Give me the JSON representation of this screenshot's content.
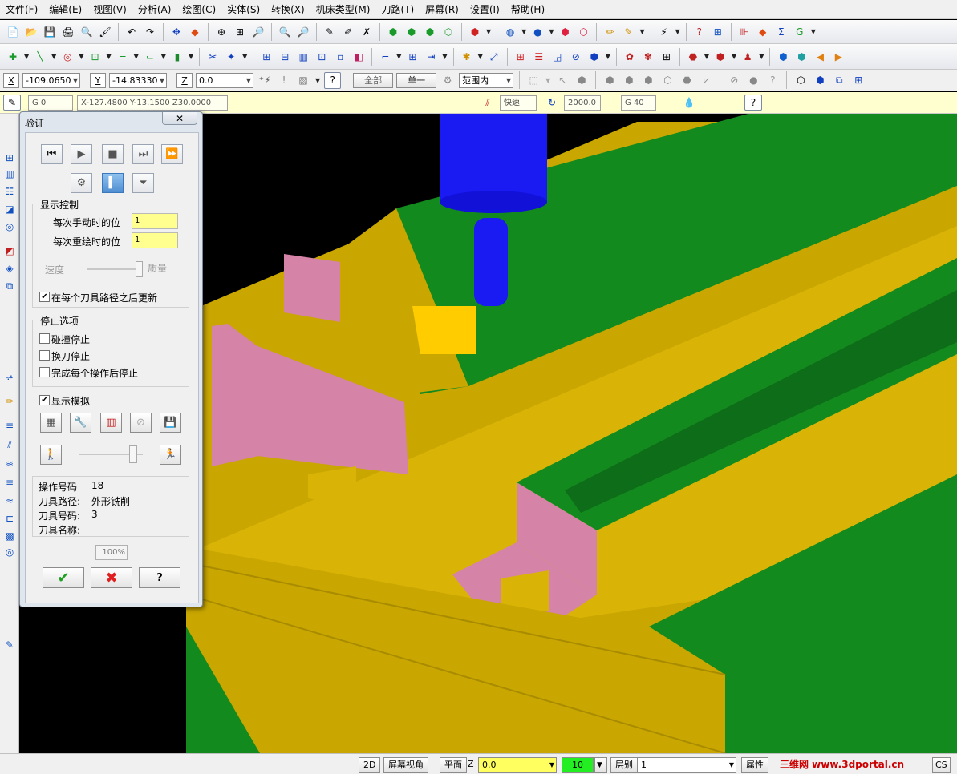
{
  "menu": [
    "文件(F)",
    "编辑(E)",
    "视图(V)",
    "分析(A)",
    "绘图(C)",
    "实体(S)",
    "转换(X)",
    "机床类型(M)",
    "刀路(T)",
    "屏幕(R)",
    "设置(I)",
    "帮助(H)"
  ],
  "coords": {
    "x_label": "X",
    "x_value": "-109.0650",
    "y_label": "Y",
    "y_value": "-14.83330",
    "z_label": "Z",
    "z_value": "0.0"
  },
  "select": {
    "all": "全部",
    "single": "单一",
    "range": "范围内"
  },
  "gcode": {
    "g": "G 0",
    "pos": "X-127.4800  Y-13.1500  Z30.0000",
    "rapid": "快速",
    "speed": "2000.0",
    "g40": "G 40"
  },
  "dialog": {
    "title": "验证",
    "display_control": "显示控制",
    "manual_steps_label": "每次手动时的位",
    "manual_steps_value": "1",
    "redraw_steps_label": "每次重绘时的位",
    "redraw_steps_value": "1",
    "speed_label": "速度",
    "quality_label": "质量",
    "update_each_path": "在每个刀具路径之后更新",
    "stop_options": "停止选项",
    "stop_collision": "碰撞停止",
    "stop_tool_change": "换刀停止",
    "stop_each_op": "完成每个操作后停止",
    "show_sim": "显示模拟",
    "op_number_label": "操作号码",
    "op_number_value": "18",
    "toolpath_label": "刀具路径:",
    "toolpath_value": "外形铣削",
    "tool_number_label": "刀具号码:",
    "tool_number_value": "3",
    "tool_name_label": "刀具名称:",
    "tool_name_value": "",
    "percent": "100%",
    "update_checked": true,
    "show_sim_checked": true,
    "slider_quality": 1.0,
    "slider_sim": 0.9
  },
  "status": {
    "view2d": "2D",
    "screen_view": "屏幕视角",
    "plane": "平面",
    "z_label": "Z",
    "z_value": "0.0",
    "color_value": "10",
    "level_label": "层别",
    "level_value": "1",
    "attrib": "属性",
    "watermark": "三维网 www.3dportal.cn",
    "gcs": "CS"
  },
  "colors": {
    "stock_top": "#c9a600",
    "stock_side": "#d9b407",
    "floor": "#138a1e",
    "wall": "#d583a6",
    "tool_holder": "#1a1af2"
  }
}
